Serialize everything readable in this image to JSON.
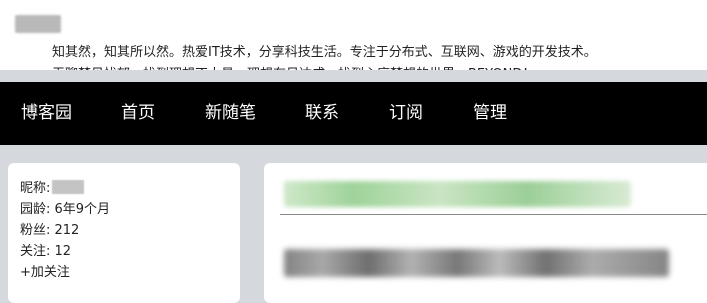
{
  "header": {
    "blog_name": "",
    "subtitle_line1": "知其然，知其所以然。热爱IT技术，分享科技生活。专注于分布式、互联网、游戏的开发技术。",
    "subtitle_line2": "无聊梦见忧郁，找到理想不太易，理想有日达成，找到心底梦想的世界。BEYOND！"
  },
  "nav": {
    "items": [
      {
        "label": "博客园"
      },
      {
        "label": "首页"
      },
      {
        "label": "新随笔"
      },
      {
        "label": "联系"
      },
      {
        "label": "订阅"
      },
      {
        "label": "管理"
      }
    ]
  },
  "profile": {
    "nickname_label": "昵称:",
    "nickname_value": "",
    "age": "园龄:  6年9个月",
    "fans": "粉丝:  212",
    "follow_count": "关注:  12",
    "follow_action": "+加关注"
  },
  "post": {
    "title": "",
    "excerpt": ""
  },
  "colors": {
    "nav_bg": "#000000",
    "page_bg": "#d5d9de",
    "card_bg": "#ffffff",
    "title_green": "#8cc985"
  }
}
